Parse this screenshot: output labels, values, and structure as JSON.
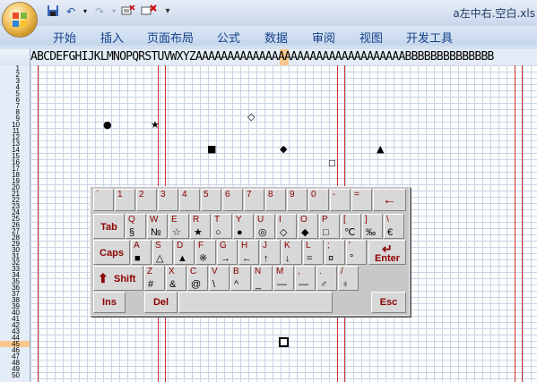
{
  "window": {
    "title": "a左中右.空白.xls"
  },
  "ribbon": {
    "tabs": [
      "开始",
      "插入",
      "页面布局",
      "公式",
      "数据",
      "审阅",
      "视图",
      "开发工具"
    ]
  },
  "quick_access": {
    "save_icon": "save-icon",
    "undo_icon": "undo-icon",
    "redo_icon": "redo-icon",
    "customize": "▾"
  },
  "sheet": {
    "column_header_text": "ABCDEFGHIJKLMNOPQRSTUVWXYZAAAAAAAAAAAAAAAAAAAAAAAAAAAAAAAAABBBBBBBBBBBBBB",
    "row_numbers": [
      "1",
      "2",
      "3",
      "4",
      "5",
      "6",
      "7",
      "8",
      "9",
      "10",
      "11",
      "12",
      "13",
      "14",
      "15",
      "16",
      "17",
      "18",
      "19",
      "20",
      "21",
      "22",
      "23",
      "24",
      "25",
      "26",
      "27",
      "28",
      "29",
      "30",
      "31",
      "32",
      "33",
      "34",
      "35",
      "36",
      "37",
      "38",
      "39",
      "40",
      "41",
      "42",
      "43",
      "44",
      "45",
      "46",
      "47",
      "48",
      "49",
      "50"
    ],
    "selected_column": "A",
    "selected_row": "44",
    "cell_symbols": [
      {
        "id": "filled-circle",
        "text": "●"
      },
      {
        "id": "black-star",
        "text": "★"
      },
      {
        "id": "diamond-outline",
        "text": "◇"
      },
      {
        "id": "filled-square",
        "text": "■"
      },
      {
        "id": "filled-diamond",
        "text": "◆"
      },
      {
        "id": "filled-triangle",
        "text": "▲"
      },
      {
        "id": "small-square",
        "text": "□"
      }
    ]
  },
  "keyboard": {
    "row1": [
      {
        "up": "`",
        "dn": ""
      },
      {
        "up": "1",
        "dn": ""
      },
      {
        "up": "2",
        "dn": ""
      },
      {
        "up": "3",
        "dn": ""
      },
      {
        "up": "4",
        "dn": ""
      },
      {
        "up": "5",
        "dn": ""
      },
      {
        "up": "6",
        "dn": ""
      },
      {
        "up": "7",
        "dn": ""
      },
      {
        "up": "8",
        "dn": ""
      },
      {
        "up": "9",
        "dn": ""
      },
      {
        "up": "0",
        "dn": ""
      },
      {
        "up": "-",
        "dn": ""
      },
      {
        "up": "=",
        "dn": ""
      }
    ],
    "backspace": "←",
    "tab": "Tab",
    "row2": [
      {
        "up": "Q",
        "dn": "§"
      },
      {
        "up": "W",
        "dn": "№"
      },
      {
        "up": "E",
        "dn": "☆"
      },
      {
        "up": "R",
        "dn": "★"
      },
      {
        "up": "T",
        "dn": "○"
      },
      {
        "up": "Y",
        "dn": "●"
      },
      {
        "up": "U",
        "dn": "◎"
      },
      {
        "up": "I",
        "dn": "◇"
      },
      {
        "up": "O",
        "dn": "◆"
      },
      {
        "up": "P",
        "dn": "□"
      },
      {
        "up": "[",
        "dn": "℃"
      },
      {
        "up": "]",
        "dn": "‰"
      },
      {
        "up": "\\",
        "dn": "€"
      }
    ],
    "caps": "Caps",
    "row3": [
      {
        "up": "A",
        "dn": "■"
      },
      {
        "up": "S",
        "dn": "△"
      },
      {
        "up": "D",
        "dn": "▲"
      },
      {
        "up": "F",
        "dn": "※"
      },
      {
        "up": "G",
        "dn": "→"
      },
      {
        "up": "H",
        "dn": "←"
      },
      {
        "up": "J",
        "dn": "↑"
      },
      {
        "up": "K",
        "dn": "↓"
      },
      {
        "up": "L",
        "dn": "="
      },
      {
        "up": ";",
        "dn": "¤"
      },
      {
        "up": "'",
        "dn": "°"
      }
    ],
    "enter": "Enter",
    "shift": "Shift",
    "row4": [
      {
        "up": "Z",
        "dn": "#"
      },
      {
        "up": "X",
        "dn": "&"
      },
      {
        "up": "C",
        "dn": "@"
      },
      {
        "up": "V",
        "dn": "\\"
      },
      {
        "up": "B",
        "dn": "^"
      },
      {
        "up": "N",
        "dn": "_"
      },
      {
        "up": "M",
        "dn": "—"
      },
      {
        "up": ",",
        "dn": "—"
      },
      {
        "up": ".",
        "dn": "♂"
      },
      {
        "up": "/",
        "dn": "♀"
      }
    ],
    "ins": "Ins",
    "del": "Del",
    "esc": "Esc"
  }
}
